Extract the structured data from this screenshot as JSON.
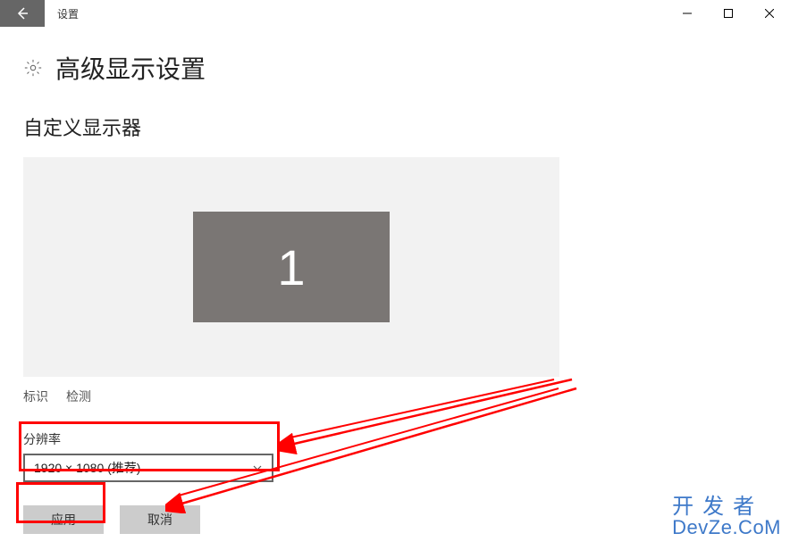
{
  "window": {
    "title": "设置"
  },
  "page": {
    "title": "高级显示设置",
    "section_title": "自定义显示器"
  },
  "monitor": {
    "number": "1"
  },
  "links": {
    "identify": "标识",
    "detect": "检测"
  },
  "resolution": {
    "label": "分辨率",
    "selected": "1920 × 1080 (推荐)"
  },
  "buttons": {
    "apply": "应用",
    "cancel": "取消"
  },
  "watermark": {
    "cn": "开发者",
    "en": "DevZe.CoM"
  }
}
